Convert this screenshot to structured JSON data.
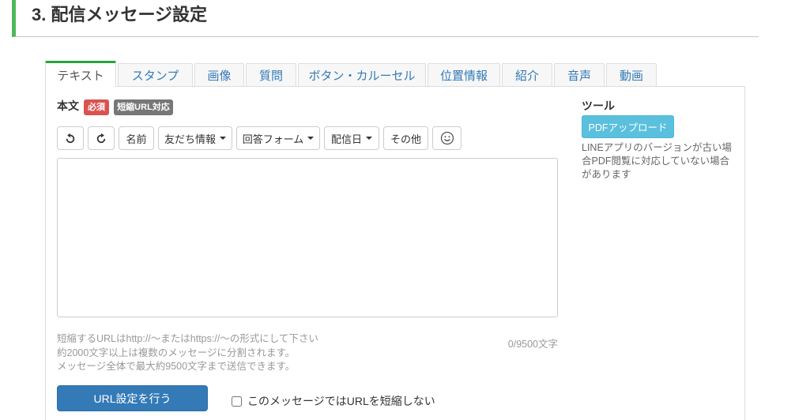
{
  "section": {
    "title": "3. 配信メッセージ設定"
  },
  "tabs": [
    {
      "label": "テキスト",
      "active": true
    },
    {
      "label": "スタンプ",
      "active": false
    },
    {
      "label": "画像",
      "active": false
    },
    {
      "label": "質問",
      "active": false
    },
    {
      "label": "ボタン・カルーセル",
      "active": false
    },
    {
      "label": "位置情報",
      "active": false
    },
    {
      "label": "紹介",
      "active": false
    },
    {
      "label": "音声",
      "active": false
    },
    {
      "label": "動画",
      "active": false
    }
  ],
  "editor": {
    "label": "本文",
    "badges": {
      "required": "必須",
      "short_url": "短縮URL対応"
    },
    "toolbar": {
      "undo_icon": "undo-icon",
      "redo_icon": "redo-icon",
      "name": "名前",
      "friend_info": "友だち情報",
      "answer_form": "回答フォーム",
      "delivery_date": "配信日",
      "other": "その他",
      "emoji_icon": "smiley-icon"
    },
    "message": {
      "value": ""
    },
    "help_lines": [
      "短縮するURLはhttp://～またはhttps://～の形式にして下さい",
      "約2000文字以上は複数のメッセージに分割されます。",
      "メッセージ全体で最大約9500文字まで送信できます。"
    ],
    "char_count": "0/9500文字",
    "url_button": "URL設定を行う",
    "no_shorten": {
      "label": "このメッセージではURLを短縮しない",
      "checked": false
    }
  },
  "tools": {
    "title": "ツール",
    "pdf_button": "PDFアップロード",
    "note": "LINEアプリのバージョンが古い場合PDF閲覧に対応していない場合があります"
  },
  "colors": {
    "section_accent": "#4fb85a",
    "active_tab_accent": "#2aa33c",
    "tab_link": "#337ab7",
    "primary_button": "#337ab7",
    "info_button": "#5bc0de",
    "required_badge": "#d9534f",
    "neutral_badge": "#777777"
  }
}
